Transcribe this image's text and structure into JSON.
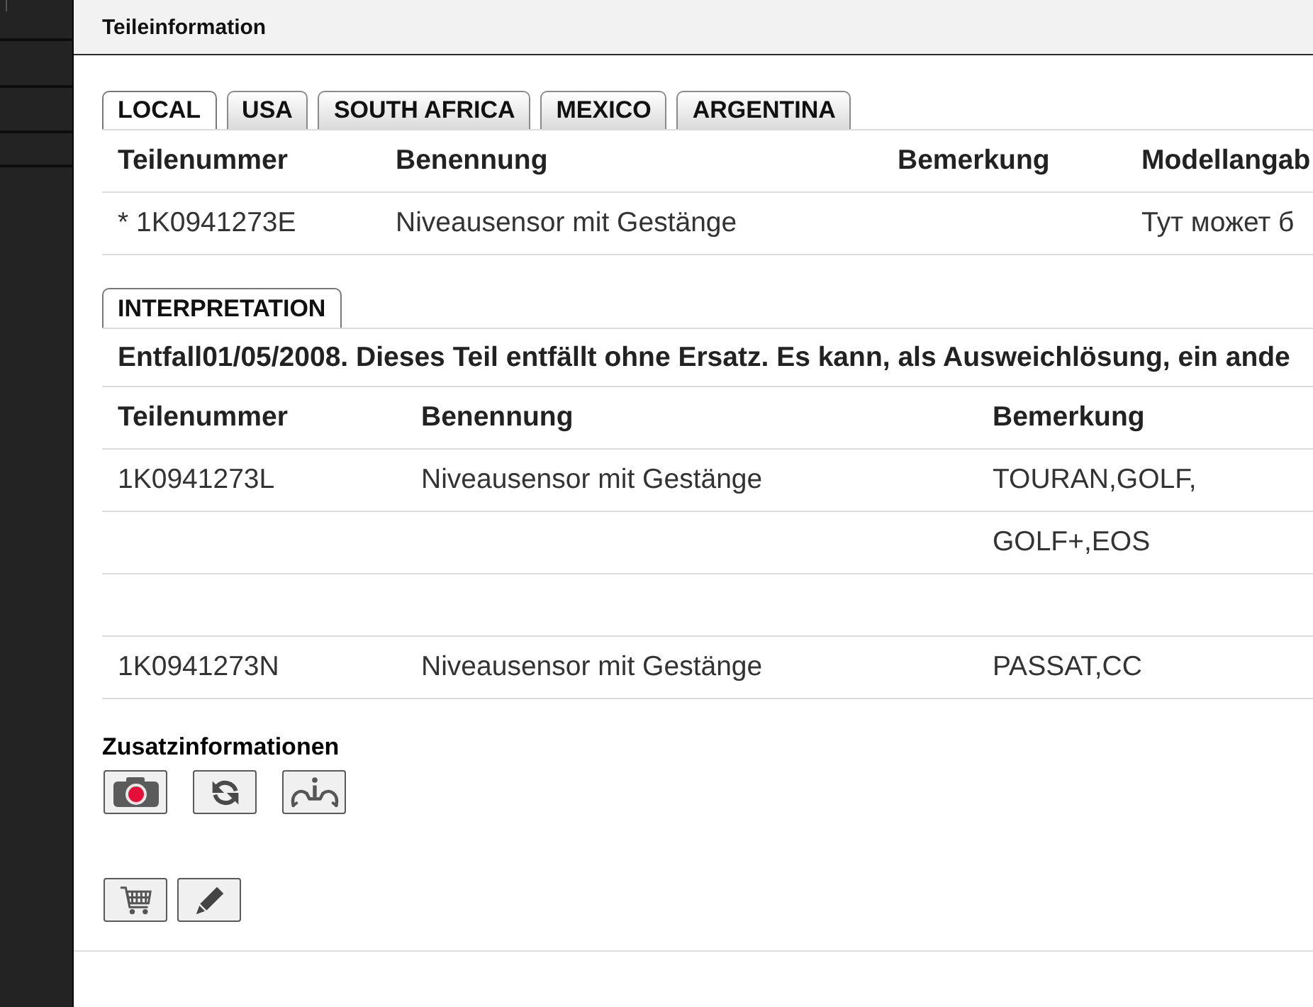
{
  "panel": {
    "title": "Teileinformation"
  },
  "market_tabs": [
    {
      "label": "LOCAL",
      "selected": true
    },
    {
      "label": "USA",
      "selected": false
    },
    {
      "label": "SOUTH AFRICA",
      "selected": false
    },
    {
      "label": "MEXICO",
      "selected": false
    },
    {
      "label": "ARGENTINA",
      "selected": false
    }
  ],
  "parts_table": {
    "columns": {
      "part_number": "Teilenummer",
      "designation": "Benennung",
      "remark": "Bemerkung",
      "column_4": "Modellangab"
    },
    "rows": [
      {
        "part_number": "* 1K0941273E",
        "designation": "Niveausensor mit Gestänge",
        "column_4": "Тут может б"
      }
    ]
  },
  "interpretation": {
    "tab": {
      "label": "INTERPRETATION",
      "selected": true
    },
    "note": "Entfall01/05/2008. Dieses Teil entfällt ohne Ersatz. Es kann, als Ausweichlösung, ein ande",
    "table": {
      "columns": {
        "part_number": "Teilenummer",
        "designation": "Benennung",
        "remark": "Bemerkung"
      },
      "rows": [
        {
          "part_number": "1K0941273L",
          "designation": "Niveausensor mit Gestänge",
          "remark": "TOURAN,GOLF,"
        },
        {
          "remark": "GOLF+,EOS"
        },
        {},
        {
          "part_number": "1K0941273N",
          "designation": "Niveausensor mit Gestänge",
          "remark": "PASSAT,CC"
        }
      ]
    }
  },
  "additional_info": {
    "heading": "Zusatzinformationen",
    "buttons": [
      {
        "kind": "camera"
      },
      {
        "kind": "refresh"
      },
      {
        "kind": "info"
      }
    ]
  },
  "actions": [
    {
      "kind": "cart"
    },
    {
      "kind": "edit"
    }
  ]
}
